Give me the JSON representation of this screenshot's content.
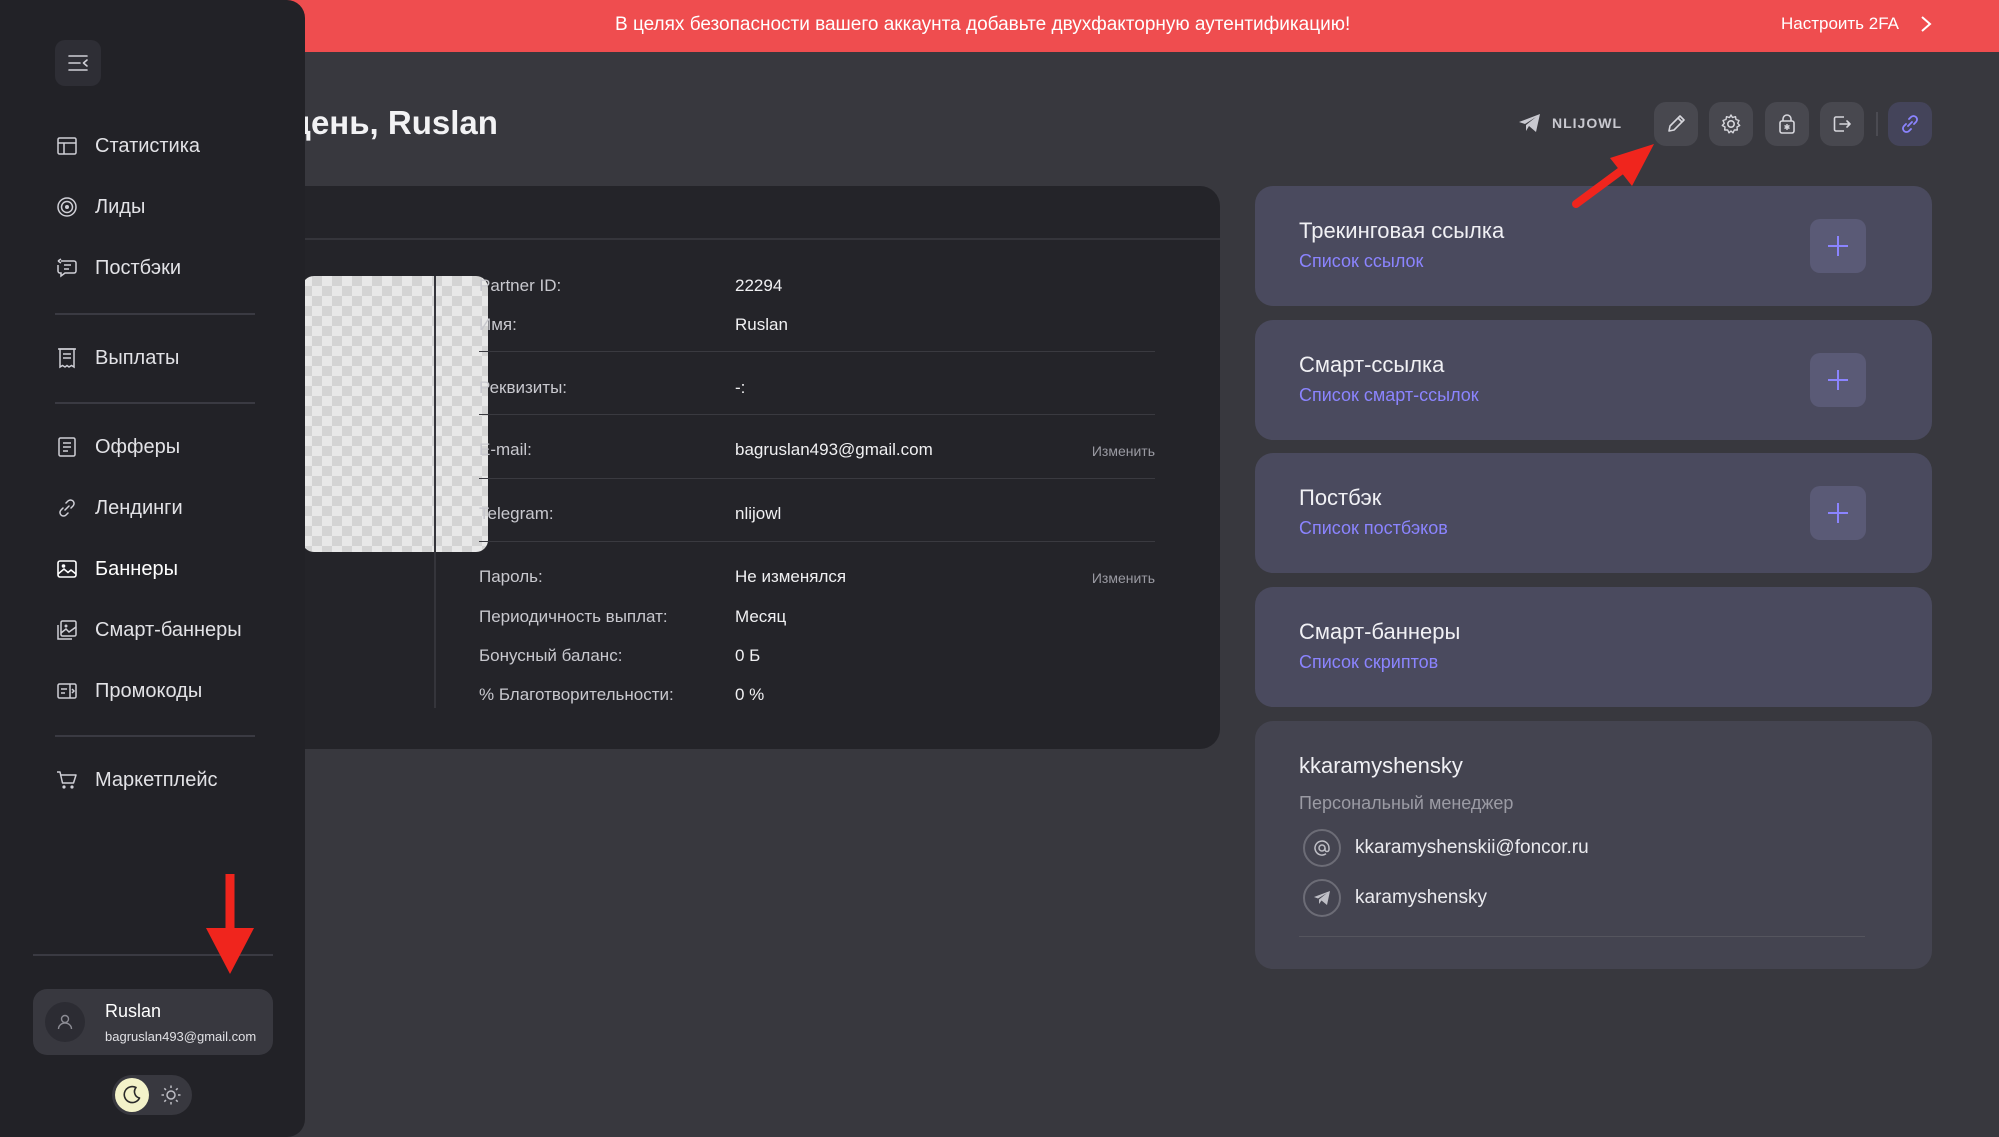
{
  "banner": {
    "message": "В целях безопасности вашего аккаунта добавьте двухфакторную аутентификацию!",
    "action_label": "Настроить 2FA"
  },
  "sidebar": {
    "items": [
      {
        "label": "Статистика",
        "icon": "table-icon"
      },
      {
        "label": "Лиды",
        "icon": "target-icon"
      },
      {
        "label": "Постбэки",
        "icon": "postback-icon"
      },
      {
        "label": "Выплаты",
        "icon": "receipt-icon"
      },
      {
        "label": "Офферы",
        "icon": "document-icon"
      },
      {
        "label": "Лендинги",
        "icon": "link-icon"
      },
      {
        "label": "Баннеры",
        "icon": "image-icon"
      },
      {
        "label": "Смарт-баннеры",
        "icon": "smart-banner-icon"
      },
      {
        "label": "Промокоды",
        "icon": "promo-icon"
      },
      {
        "label": "Маркетплейс",
        "icon": "cart-icon"
      }
    ],
    "user": {
      "name": "Ruslan",
      "email": "bagruslan493@gmail.com"
    }
  },
  "header": {
    "title": "день, Ruslan",
    "telegram_handle": "NLIJOWL"
  },
  "profile": {
    "rows": [
      {
        "label": "Partner ID:",
        "value": "22294"
      },
      {
        "label": "Имя:",
        "value": "Ruslan"
      },
      {
        "label": "Реквизиты:",
        "value": "-:"
      },
      {
        "label": "E-mail:",
        "value": "bagruslan493@gmail.com",
        "action": "Изменить"
      },
      {
        "label": "Telegram:",
        "value": "nlijowl"
      },
      {
        "label": "Пароль:",
        "value": "Не изменялся",
        "action": "Изменить"
      },
      {
        "label": "Периодичность выплат:",
        "value": "Месяц"
      },
      {
        "label": "Бонусный баланс:",
        "value": "0 Б"
      },
      {
        "label": "% Благотворительности:",
        "value": "0 %"
      }
    ]
  },
  "cards": [
    {
      "title": "Трекинговая ссылка",
      "link": "Список ссылок"
    },
    {
      "title": "Смарт-ссылка",
      "link": "Список смарт-ссылок"
    },
    {
      "title": "Постбэк",
      "link": "Список постбэков"
    },
    {
      "title": "Смарт-баннеры",
      "link": "Список скриптов"
    }
  ],
  "manager": {
    "name": "kkaramyshensky",
    "role": "Персональный менеджер",
    "email": "kkaramyshenskii@foncor.ru",
    "telegram": "karamyshensky"
  },
  "colors": {
    "banner": "#ef4d4f",
    "accent": "#8b84ff",
    "sidebar": "#222227",
    "background": "#38383e"
  }
}
